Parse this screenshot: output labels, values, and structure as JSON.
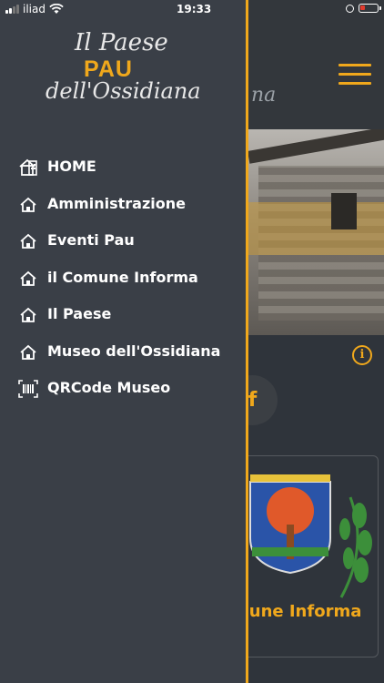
{
  "status_bar": {
    "carrier": "iliad",
    "time": "19:33"
  },
  "header": {
    "title_fragment": "na"
  },
  "drawer": {
    "logo": {
      "line1": "Il Paese",
      "line2": "PAU",
      "line3": "dell'Ossidiana"
    },
    "items": [
      {
        "label": "HOME",
        "icon": "home-grid-icon"
      },
      {
        "label": "Amministrazione",
        "icon": "home-icon"
      },
      {
        "label": "Eventi Pau",
        "icon": "home-icon"
      },
      {
        "label": "il Comune Informa",
        "icon": "home-icon"
      },
      {
        "label": "Il Paese",
        "icon": "home-icon"
      },
      {
        "label": "Museo dell'Ossidiana",
        "icon": "home-icon"
      },
      {
        "label": "QRCode Museo",
        "icon": "qrcode-icon"
      }
    ]
  },
  "main": {
    "facebook_letter": "f",
    "card_label": "mune Informa"
  },
  "colors": {
    "accent": "#f0a81c",
    "drawer_bg": "#3a3f47",
    "battery_low": "#e23b2e"
  }
}
